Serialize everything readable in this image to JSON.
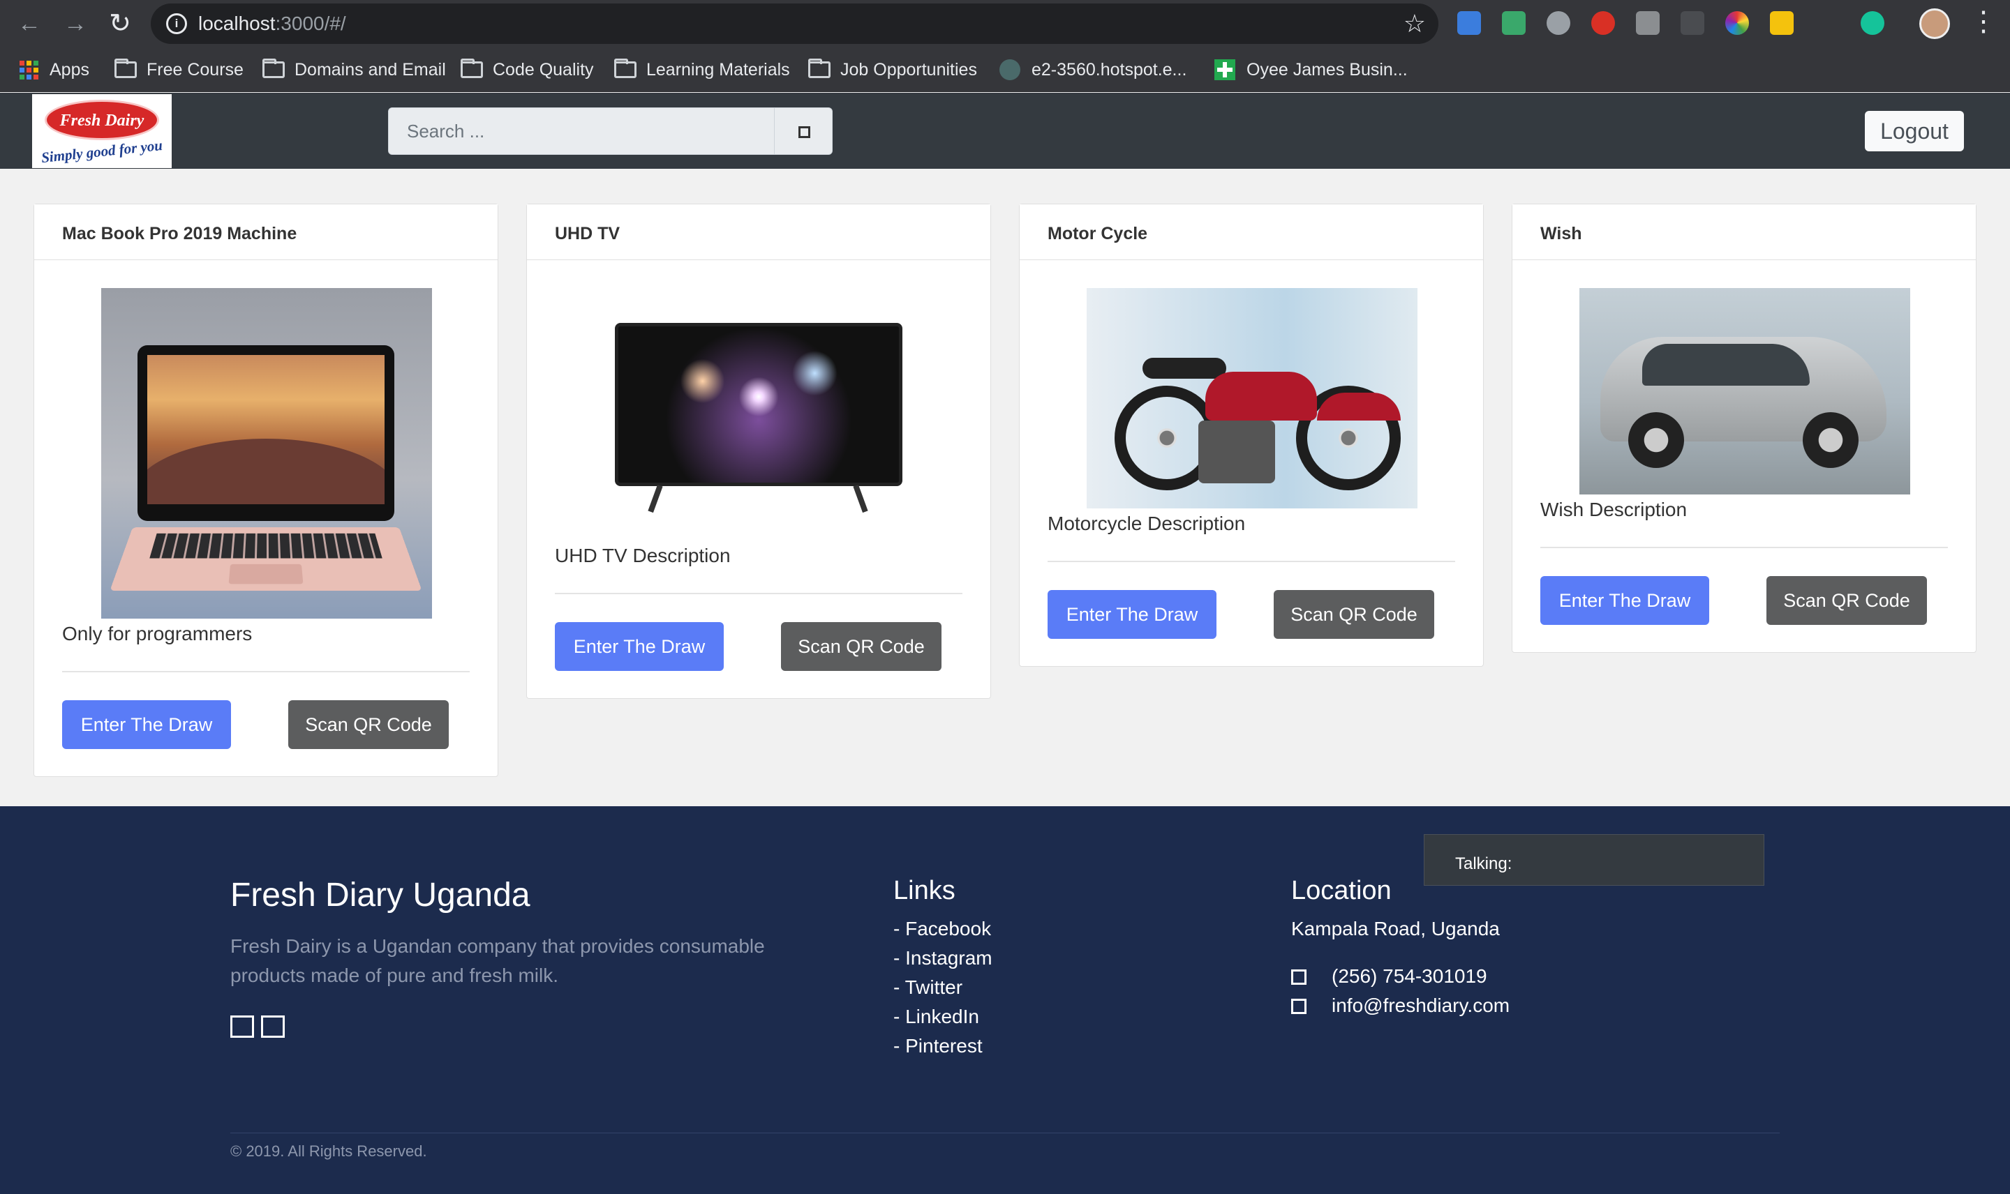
{
  "browser": {
    "url_host": "localhost",
    "url_rest": ":3000/#/",
    "bookmarks": [
      {
        "label": "Apps"
      },
      {
        "label": "Free Course"
      },
      {
        "label": "Domains and Email"
      },
      {
        "label": "Code Quality"
      },
      {
        "label": "Learning Materials"
      },
      {
        "label": "Job Opportunities"
      },
      {
        "label": "e2-3560.hotspot.e..."
      },
      {
        "label": "Oyee James Busin..."
      }
    ]
  },
  "navbar": {
    "logo_name": "Fresh Dairy",
    "logo_tagline": "Simply good for you",
    "search_placeholder": "Search ...",
    "logout_label": "Logout"
  },
  "cards": [
    {
      "title": "Mac Book Pro 2019 Machine",
      "description": "Only for programmers",
      "image_icon": "laptop-image",
      "primary_label": "Enter The Draw",
      "secondary_label": "Scan QR Code"
    },
    {
      "title": "UHD TV",
      "description": "UHD TV Description",
      "image_icon": "tv-image",
      "primary_label": "Enter The Draw",
      "secondary_label": "Scan QR Code"
    },
    {
      "title": "Motor Cycle",
      "description": "Motorcycle Description",
      "image_icon": "motorcycle-image",
      "primary_label": "Enter The Draw",
      "secondary_label": "Scan QR Code"
    },
    {
      "title": "Wish",
      "description": "Wish Description",
      "image_icon": "car-image",
      "primary_label": "Enter The Draw",
      "secondary_label": "Scan QR Code"
    }
  ],
  "footer": {
    "title": "Fresh Diary Uganda",
    "about": "Fresh Dairy is a Ugandan company that provides consumable products made of pure and fresh milk.",
    "links_heading": "Links",
    "links": [
      "- Facebook",
      "- Instagram",
      "- Twitter",
      "- LinkedIn",
      "- Pinterest"
    ],
    "location_heading": "Location",
    "address": "Kampala Road, Uganda",
    "phone": "(256) 754-301019",
    "email": "info@freshdiary.com",
    "copyright": "© 2019. All Rights Reserved."
  },
  "popup": {
    "label": "Talking:"
  },
  "colors": {
    "primary_button": "#5a7cf7",
    "secondary_button": "#5c5d5e",
    "footer_bg": "#1c2b4d",
    "navbar_bg": "#343a40"
  }
}
